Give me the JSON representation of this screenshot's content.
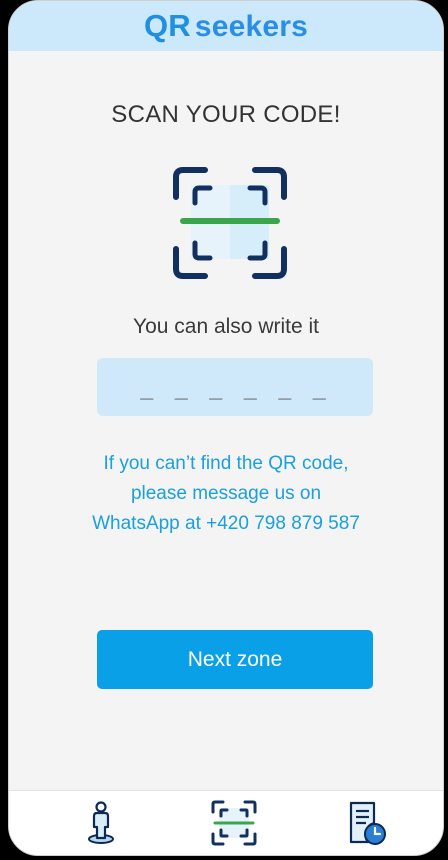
{
  "header": {
    "logo_qr": "QR",
    "logo_seekers": "seekers"
  },
  "main": {
    "title": "SCAN YOUR CODE!",
    "scan_icon": "qr-scan-icon",
    "subtitle": "You can also write it",
    "code_input": {
      "placeholder": "_ _ _   _ _ _",
      "value": ""
    },
    "help_line1": "If you can’t find the QR code,",
    "help_line2": "please message us on",
    "help_line3": "WhatsApp at +420 798 879 587",
    "next_button_label": "Next zone"
  },
  "bottom_nav": {
    "items": [
      {
        "icon": "person-location-icon"
      },
      {
        "icon": "qr-scan-icon",
        "active": true
      },
      {
        "icon": "history-document-icon"
      }
    ]
  },
  "colors": {
    "accent": "#0aa0e7",
    "header_bg": "#cbe9fb",
    "input_bg": "#cfe9fb",
    "help_text": "#1aa0dd",
    "scan_frame": "#12305f",
    "scan_line": "#3aa64c"
  }
}
